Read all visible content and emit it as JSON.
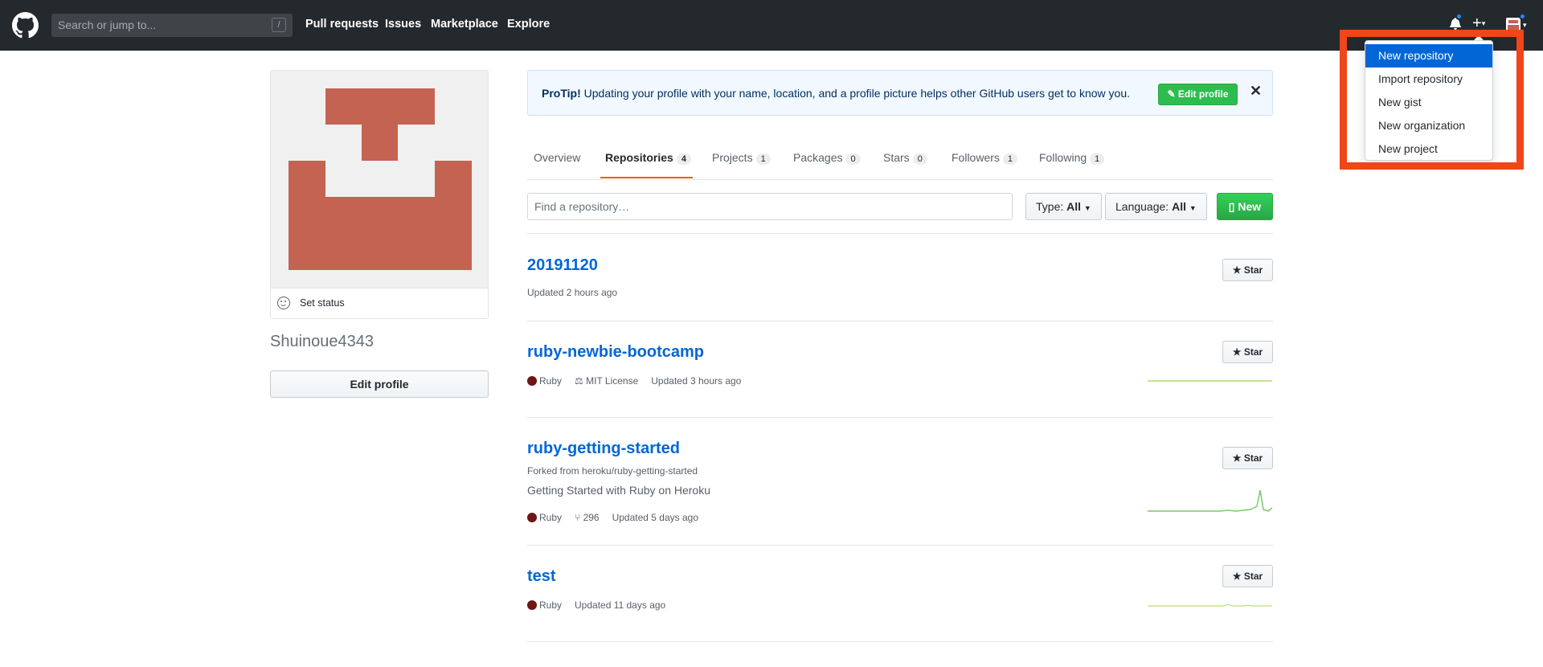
{
  "header": {
    "search_placeholder": "Search or jump to...",
    "search_shortcut": "/",
    "nav": [
      "Pull requests",
      "Issues",
      "Marketplace",
      "Explore"
    ],
    "icons": [
      "github-logo-icon",
      "bell-icon",
      "plus-icon",
      "avatar-icon"
    ]
  },
  "dropdown": {
    "items": [
      "New repository",
      "Import repository",
      "New gist",
      "New organization",
      "New project"
    ],
    "active_index": 0
  },
  "profile": {
    "set_status": "Set status",
    "username": "Shuinoue4343",
    "edit_profile": "Edit profile",
    "avatar_color": "#c46352"
  },
  "protip": {
    "label": "ProTip!",
    "text": "Updating your profile with your name, location, and a profile picture helps other GitHub users get to know you.",
    "button": "Edit profile",
    "close": "✕"
  },
  "tabs": [
    {
      "label": "Overview",
      "count": null
    },
    {
      "label": "Repositories",
      "count": "4"
    },
    {
      "label": "Projects",
      "count": "1"
    },
    {
      "label": "Packages",
      "count": "0"
    },
    {
      "label": "Stars",
      "count": "0"
    },
    {
      "label": "Followers",
      "count": "1"
    },
    {
      "label": "Following",
      "count": "1"
    }
  ],
  "filters": {
    "find_placeholder": "Find a repository…",
    "type_label": "Type:",
    "type_value": "All",
    "language_label": "Language:",
    "language_value": "All",
    "new_label": "New"
  },
  "repos": [
    {
      "name": "20191120",
      "updated": "Updated 2 hours ago"
    },
    {
      "name": "ruby-newbie-bootcamp",
      "language": "Ruby",
      "license": "MIT License",
      "updated": "Updated 3 hours ago"
    },
    {
      "name": "ruby-getting-started",
      "forked_from": "Forked from heroku/ruby-getting-started",
      "description": "Getting Started with Ruby on Heroku",
      "language": "Ruby",
      "forks": "296",
      "updated": "Updated 5 days ago"
    },
    {
      "name": "test",
      "language": "Ruby",
      "updated": "Updated 11 days ago"
    }
  ],
  "star_label": "Star",
  "colors": {
    "accent_blue": "#0366d6",
    "green": "#28a745",
    "ruby": "#701516",
    "tab_underline": "#e36209",
    "highlight_box": "#f1451a"
  }
}
